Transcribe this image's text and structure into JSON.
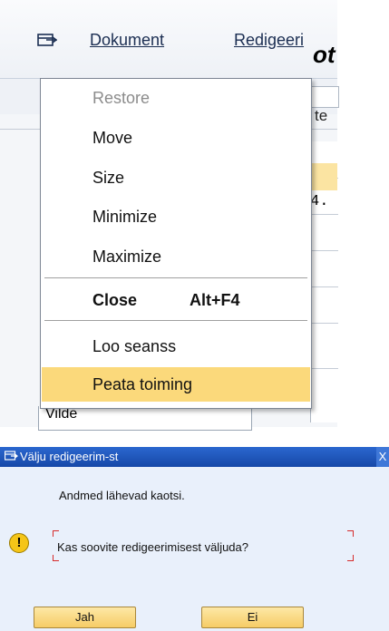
{
  "menubar": {
    "items": [
      {
        "label": "Dokument"
      },
      {
        "label": "Redigeeri"
      }
    ]
  },
  "background": {
    "partial_texts": [
      "ot",
      "te",
      "4.",
      "Vilde"
    ]
  },
  "system_menu": {
    "items": [
      {
        "label": "Restore",
        "enabled": false
      },
      {
        "label": "Move",
        "enabled": true
      },
      {
        "label": "Size",
        "enabled": true
      },
      {
        "label": "Minimize",
        "enabled": true
      },
      {
        "label": "Maximize",
        "enabled": true
      },
      {
        "label": "Close",
        "shortcut": "Alt+F4",
        "enabled": true
      },
      {
        "label": "Loo seanss",
        "enabled": true
      },
      {
        "label": "Peata toiming",
        "enabled": true,
        "highlighted": true
      }
    ]
  },
  "dialog": {
    "title": "Välju redigeerim-st",
    "close_label": "X",
    "message": "Andmed lähevad kaotsi.",
    "question": "Kas soovite redigeerimisest väljuda?",
    "buttons": {
      "yes": "Jah",
      "no": "Ei"
    }
  },
  "colors": {
    "highlight": "#fbd97b",
    "title_bar": "#1f58bd",
    "button": "#f6cc66",
    "focus_corner": "#d62b2b"
  }
}
